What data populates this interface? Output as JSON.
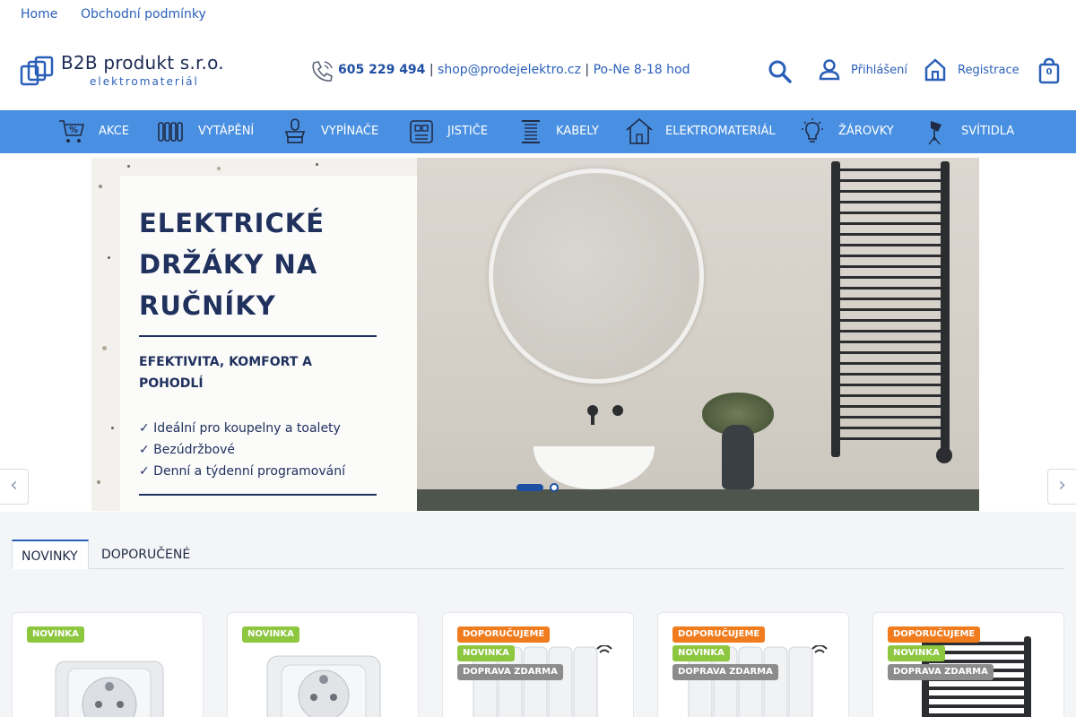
{
  "top_links": [
    "Home",
    "Obchodní podmínky"
  ],
  "logo": {
    "name": "B2B produkt s.r.o.",
    "sub": "elektromateriál"
  },
  "contact": {
    "phone": "605 229 494",
    "sep1": " | ",
    "email": "shop@prodejelektro.cz",
    "sep2": " | ",
    "hours": "Po-Ne 8-18 hod"
  },
  "account": {
    "login": "Přihlášení",
    "register": "Registrace",
    "cart_count": "0"
  },
  "nav": [
    "AKCE",
    "VYTÁPĚNÍ",
    "VYPÍNAČE",
    "JISTIČE",
    "KABELY",
    "ELEKTROMATERIÁL",
    "ŽÁROVKY",
    "SVÍTIDLA"
  ],
  "banner": {
    "title_lines": [
      "ELEKTRICKÉ",
      "DRŽÁKY NA",
      "RUČNÍKY"
    ],
    "subtitle_lines": [
      "EFEKTIVITA, KOMFORT A",
      "POHODLÍ"
    ],
    "features": [
      "✓ Ideální pro koupelny a toalety",
      "✓ Bezúdržbové",
      "✓ Denní a týdenní programování"
    ],
    "slides_total": 2,
    "active_slide": 1
  },
  "tabs": [
    "NOVINKY",
    "DOPORUČENÉ"
  ],
  "products": [
    {
      "badges": [
        "NOVINKA"
      ]
    },
    {
      "badges": [
        "NOVINKA"
      ]
    },
    {
      "badges": [
        "DOPORUČUJEME",
        "NOVINKA",
        "DOPRAVA ZDARMA"
      ]
    },
    {
      "badges": [
        "DOPORUČUJEME",
        "NOVINKA",
        "DOPRAVA ZDARMA"
      ]
    },
    {
      "badges": [
        "DOPORUČUJEME",
        "NOVINKA",
        "DOPRAVA ZDARMA"
      ]
    }
  ],
  "colors": {
    "nav_bg": "#4a90e2",
    "brand_blue": "#2a5fb8",
    "dark_navy": "#20315e",
    "badge_new": "#8dc63f",
    "badge_recommend": "#f07c1e",
    "badge_shipping": "#8c8c8c"
  }
}
